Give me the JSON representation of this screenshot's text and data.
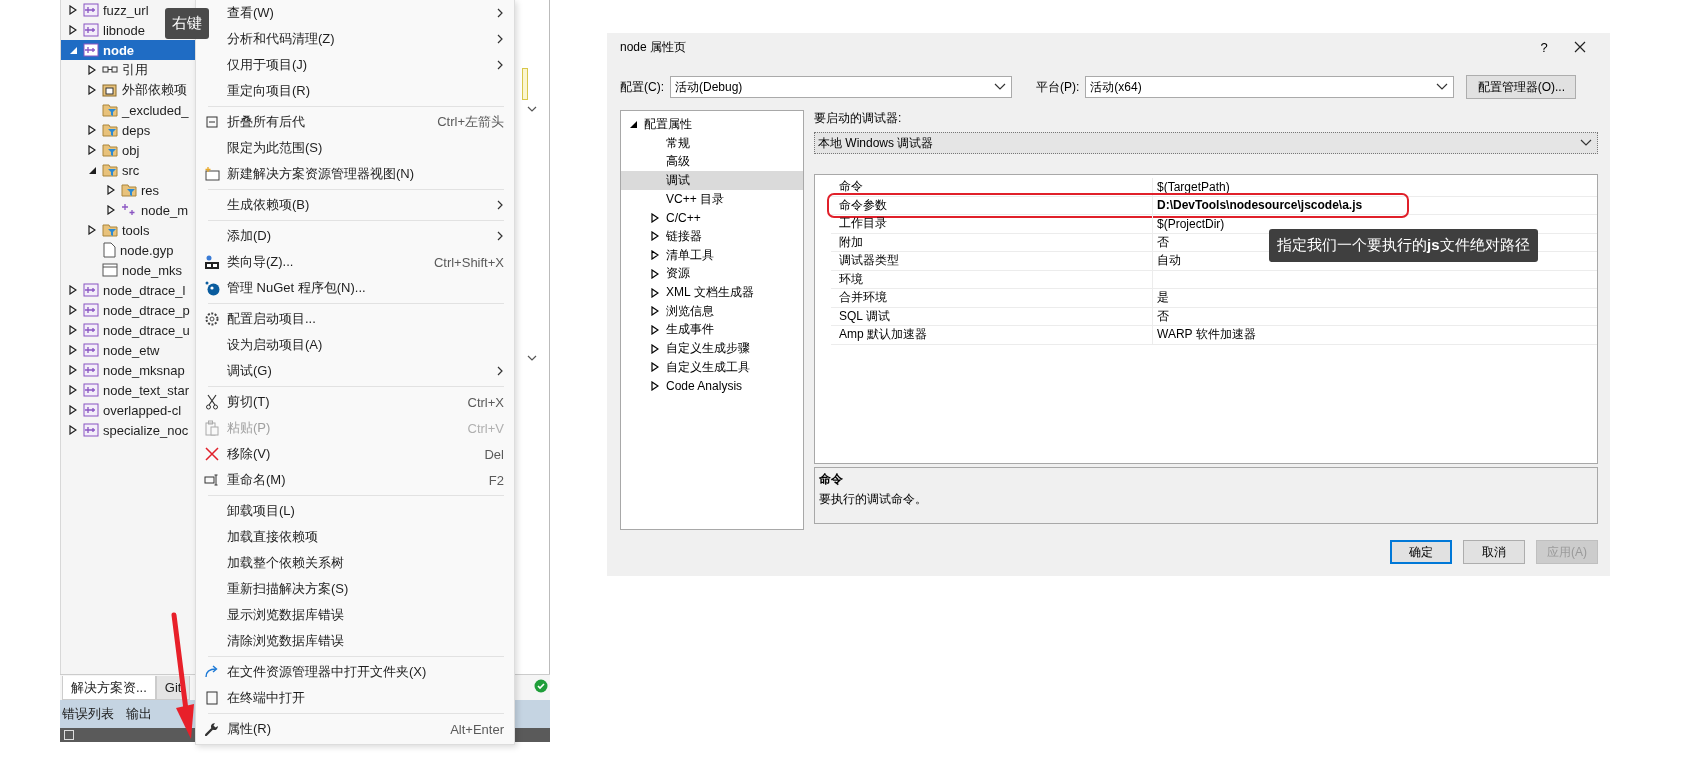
{
  "annotation_label": "右键",
  "explorer": {
    "tree": [
      {
        "label": "fuzz_url",
        "kind": "project",
        "expanded": false,
        "selected": false
      },
      {
        "label": "libnode",
        "kind": "project",
        "expanded": false,
        "selected": false
      },
      {
        "label": "node",
        "kind": "project",
        "expanded": true,
        "selected": true,
        "children": [
          {
            "label": "引用",
            "kind": "references",
            "expanded": false,
            "selected": false
          },
          {
            "label": "外部依赖项",
            "kind": "external",
            "expanded": false,
            "selected": false
          },
          {
            "label": "_excluded_",
            "kind": "filter",
            "selected": false
          },
          {
            "label": "deps",
            "kind": "filter",
            "expanded": false,
            "selected": false
          },
          {
            "label": "obj",
            "kind": "filter",
            "expanded": false,
            "selected": false
          },
          {
            "label": "src",
            "kind": "filter",
            "expanded": true,
            "selected": false,
            "children": [
              {
                "label": "res",
                "kind": "filter",
                "expanded": false,
                "selected": false
              },
              {
                "label": "node_m",
                "kind": "source",
                "expanded": false,
                "selected": false
              }
            ]
          },
          {
            "label": "tools",
            "kind": "filter",
            "expanded": false,
            "selected": false
          },
          {
            "label": "node.gyp",
            "kind": "file",
            "selected": false
          },
          {
            "label": "node_mks",
            "kind": "page",
            "selected": false
          }
        ]
      },
      {
        "label": "node_dtrace_l",
        "kind": "project",
        "expanded": false,
        "selected": false
      },
      {
        "label": "node_dtrace_p",
        "kind": "project",
        "expanded": false,
        "selected": false
      },
      {
        "label": "node_dtrace_u",
        "kind": "project",
        "expanded": false,
        "selected": false
      },
      {
        "label": "node_etw",
        "kind": "project",
        "expanded": false,
        "selected": false
      },
      {
        "label": "node_mksnap",
        "kind": "project",
        "expanded": false,
        "selected": false
      },
      {
        "label": "node_text_star",
        "kind": "project",
        "expanded": false,
        "selected": false
      },
      {
        "label": "overlapped-cl",
        "kind": "project",
        "expanded": false,
        "selected": false
      },
      {
        "label": "specialize_noc",
        "kind": "project",
        "expanded": false,
        "selected": false
      }
    ],
    "tabs": [
      {
        "label": "解决方案资...",
        "selected": true
      },
      {
        "label": "Git",
        "selected": false
      }
    ],
    "output_tabs": [
      {
        "label": "错误列表"
      },
      {
        "label": "输出"
      }
    ]
  },
  "context_menu": {
    "groups": [
      {
        "items": [
          {
            "label": "查看(W)",
            "submenu": true,
            "disabled": false
          },
          {
            "label": "分析和代码清理(Z)",
            "submenu": true,
            "disabled": false
          },
          {
            "label": "仅用于项目(J)",
            "submenu": true,
            "disabled": false
          },
          {
            "label": "重定向项目(R)",
            "submenu": false,
            "disabled": false
          }
        ]
      },
      {
        "items": [
          {
            "label": "折叠所有后代",
            "kind": "collapse",
            "shortcut": "Ctrl+左箭头",
            "submenu": false,
            "disabled": false
          },
          {
            "label": "限定为此范围(S)",
            "submenu": false,
            "disabled": false
          },
          {
            "label": "新建解决方案资源管理器视图(N)",
            "kind": "new-view",
            "submenu": false,
            "disabled": false
          }
        ]
      },
      {
        "items": [
          {
            "label": "生成依赖项(B)",
            "submenu": true,
            "disabled": false
          }
        ]
      },
      {
        "items": [
          {
            "label": "添加(D)",
            "submenu": true,
            "disabled": false
          },
          {
            "label": "类向导(Z)...",
            "kind": "wizard",
            "shortcut": "Ctrl+Shift+X",
            "submenu": false,
            "disabled": false
          },
          {
            "label": "管理 NuGet 程序包(N)...",
            "kind": "package",
            "submenu": false,
            "disabled": false
          }
        ]
      },
      {
        "items": [
          {
            "label": "配置启动项目...",
            "kind": "gear",
            "submenu": false,
            "disabled": false
          },
          {
            "label": "设为启动项目(A)",
            "submenu": false,
            "disabled": false
          },
          {
            "label": "调试(G)",
            "submenu": true,
            "disabled": false
          }
        ]
      },
      {
        "items": [
          {
            "label": "剪切(T)",
            "kind": "cut",
            "shortcut": "Ctrl+X",
            "submenu": false,
            "disabled": false
          },
          {
            "label": "粘贴(P)",
            "kind": "paste",
            "shortcut": "Ctrl+V",
            "submenu": false,
            "disabled": true
          },
          {
            "label": "移除(V)",
            "kind": "remove",
            "shortcut": "Del",
            "submenu": false,
            "disabled": false
          },
          {
            "label": "重命名(M)",
            "kind": "rename",
            "shortcut": "F2",
            "submenu": false,
            "disabled": false
          }
        ]
      },
      {
        "items": [
          {
            "label": "卸载项目(L)",
            "submenu": false,
            "disabled": false
          },
          {
            "label": "加载直接依赖项",
            "submenu": false,
            "disabled": false
          },
          {
            "label": "加载整个依赖关系树",
            "submenu": false,
            "disabled": false
          },
          {
            "label": "重新扫描解决方案(S)",
            "submenu": false,
            "disabled": false
          },
          {
            "label": "显示浏览数据库错误",
            "submenu": false,
            "disabled": false
          },
          {
            "label": "清除浏览数据库错误",
            "submenu": false,
            "disabled": false
          }
        ]
      },
      {
        "items": [
          {
            "label": "在文件资源管理器中打开文件夹(X)",
            "kind": "open-folder",
            "submenu": false,
            "disabled": false
          },
          {
            "label": "在终端中打开",
            "kind": "terminal",
            "submenu": false,
            "disabled": false
          }
        ]
      },
      {
        "items": [
          {
            "label": "属性(R)",
            "kind": "wrench",
            "shortcut": "Alt+Enter",
            "submenu": false,
            "disabled": false
          }
        ]
      }
    ]
  },
  "dialog": {
    "title": "node 属性页",
    "help_button": "?",
    "config": {
      "label": "配置(C):",
      "value": "活动(Debug)"
    },
    "platform": {
      "label": "平台(P):",
      "value": "活动(x64)"
    },
    "manager_button": "配置管理器(O)...",
    "tree": [
      {
        "label": "配置属性",
        "expanded": true,
        "selected": false,
        "children": [
          {
            "label": "常规",
            "selected": false
          },
          {
            "label": "高级",
            "selected": false
          },
          {
            "label": "调试",
            "selected": true
          },
          {
            "label": "VC++ 目录",
            "selected": false
          },
          {
            "label": "C/C++",
            "expanded": false,
            "selected": false
          },
          {
            "label": "链接器",
            "expanded": false,
            "selected": false
          },
          {
            "label": "清单工具",
            "expanded": false,
            "selected": false
          },
          {
            "label": "资源",
            "expanded": false,
            "selected": false
          },
          {
            "label": "XML 文档生成器",
            "expanded": false,
            "selected": false
          },
          {
            "label": "浏览信息",
            "expanded": false,
            "selected": false
          },
          {
            "label": "生成事件",
            "expanded": false,
            "selected": false
          },
          {
            "label": "自定义生成步骤",
            "expanded": false,
            "selected": false
          },
          {
            "label": "自定义生成工具",
            "expanded": false,
            "selected": false
          },
          {
            "label": "Code Analysis",
            "expanded": false,
            "selected": false
          }
        ]
      }
    ],
    "debugger_label": "要启动的调试器:",
    "debugger_value": "本地 Windows 调试器",
    "properties": [
      {
        "name": "命令",
        "value": "$(TargetPath)",
        "modified": false,
        "highlighted": false
      },
      {
        "name": "命令参数",
        "value": "D:\\DevTools\\nodesource\\jscode\\a.js",
        "modified": true,
        "highlighted": true
      },
      {
        "name": "工作目录",
        "value": "$(ProjectDir)",
        "modified": false,
        "highlighted": false
      },
      {
        "name": "附加",
        "value": "否",
        "modified": false,
        "highlighted": false
      },
      {
        "name": "调试器类型",
        "value": "自动",
        "modified": false,
        "highlighted": false
      },
      {
        "name": "环境",
        "highlighted": false
      },
      {
        "name": "合并环境",
        "value": "是",
        "modified": false,
        "highlighted": false
      },
      {
        "name": "SQL 调试",
        "value": "否",
        "modified": false,
        "highlighted": false
      },
      {
        "name": "Amp 默认加速器",
        "value": "WARP 软件加速器",
        "modified": false,
        "highlighted": false
      }
    ],
    "callout": "指定我们一个要执行的**js**文件绝对路径",
    "description": {
      "title": "命令",
      "text": "要执行的调试命令。"
    },
    "buttons": [
      {
        "label": "确定",
        "kind": "default"
      },
      {
        "label": "取消",
        "kind": "normal"
      },
      {
        "label": "应用(A)",
        "kind": "disabled"
      }
    ]
  }
}
